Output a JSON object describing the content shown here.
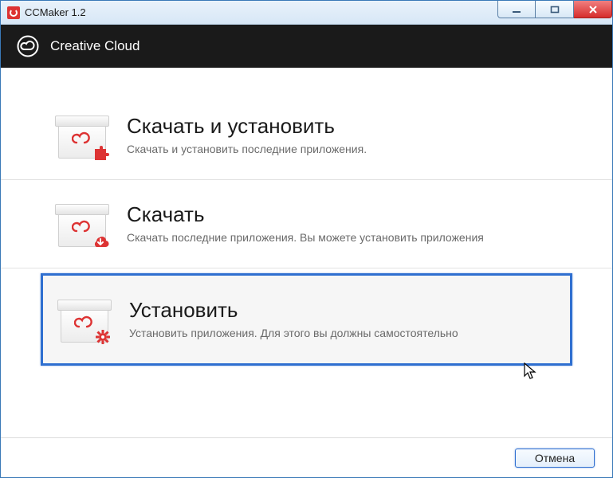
{
  "window": {
    "title": "CCMaker 1.2"
  },
  "banner": {
    "title": "Creative Cloud"
  },
  "options": [
    {
      "title": "Скачать и установить",
      "desc": "Скачать и установить последние приложения."
    },
    {
      "title": "Скачать",
      "desc": "Скачать последние приложения. Вы можете установить приложения"
    },
    {
      "title": "Установить",
      "desc": "Установить приложения. Для этого вы должны самостоятельно"
    }
  ],
  "footer": {
    "cancel_label": "Отмена"
  }
}
